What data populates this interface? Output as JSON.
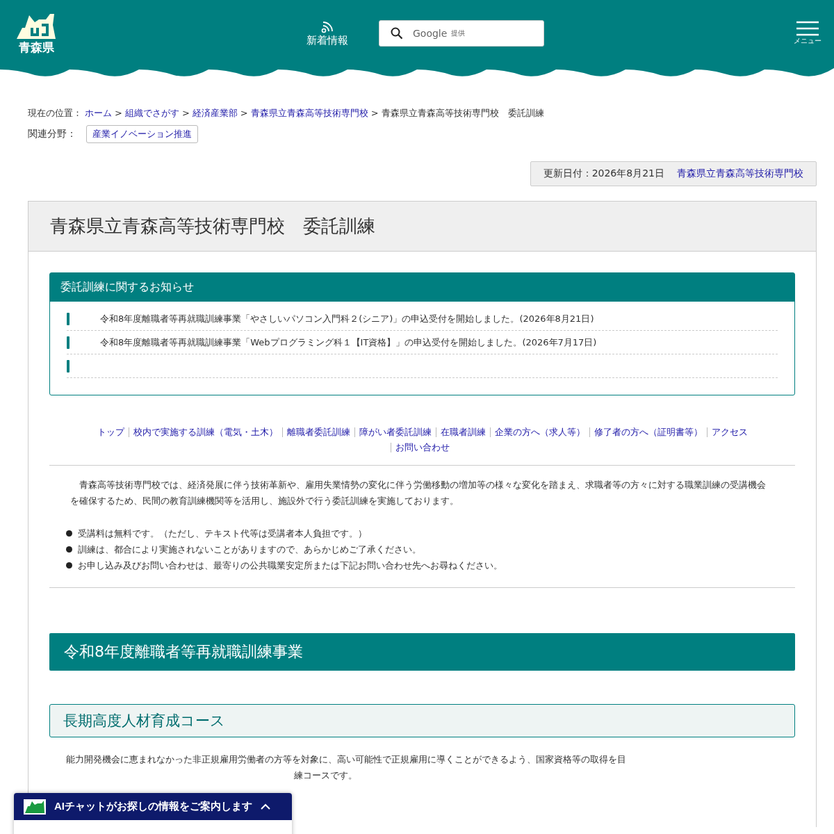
{
  "header": {
    "logo_text": "青森県",
    "news_label": "新着情報",
    "search": {
      "brand": "Google",
      "suffix": "提供"
    },
    "menu_label": "メニュー"
  },
  "breadcrumb": {
    "label": "現在の位置：",
    "separator": ">",
    "items": [
      {
        "text": "ホーム",
        "link": true
      },
      {
        "text": "組織でさがす",
        "link": true
      },
      {
        "text": "経済産業部",
        "link": true
      },
      {
        "text": "青森県立青森高等技術専門校",
        "link": true
      },
      {
        "text": "青森県立青森高等技術専門校　委託訓練",
        "link": false
      }
    ]
  },
  "related": {
    "label": "関連分野：",
    "tags": [
      "産業イノベーション推進"
    ]
  },
  "updated": {
    "date": "更新日付：2026年8月21日",
    "department": "青森県立青森高等技術専門校"
  },
  "title": "青森県立青森高等技術専門校　委託訓練",
  "notice": {
    "heading": "委託訓練に関するお知らせ",
    "items": [
      {
        "kind": "notice",
        "text": "令和8年度離職者等再就職訓練事業「やさしいパソコン入門科２(シニア)」の申込受付を開始しました。(2026年8月21日)"
      },
      {
        "kind": "notice",
        "text": "令和8年度離職者等再就職訓練事業「Webプログラミング科１【IT資格】」の申込受付を開始しました。(2026年7月17日)"
      },
      {
        "kind": "blank"
      }
    ]
  },
  "nav_links": [
    "トップ",
    "校内で実施する訓練（電気・土木）",
    "離職者委託訓練",
    "障がい者委託訓練",
    "在職者訓練",
    "企業の方へ（求人等）",
    "修了者の方へ（証明書等）",
    "アクセス",
    "お問い合わせ"
  ],
  "intro": "　青森高等技術専門校では、経済発展に伴う技術革新や、雇用失業情勢の変化に伴う労働移動の増加等の様々な変化を踏まえ、求職者等の方々に対する職業訓練の受講機会を確保するため、民間の教育訓練機関等を活用し、施設外で行う委託訓練を実施しております。",
  "bullets": [
    "受講料は無料です。（ただし、テキスト代等は受講者本人負担です。）",
    "訓練は、都合により実施されないことがありますので、あらかじめご了承ください。",
    "お申し込み及びお問い合わせは、最寄りの公共職業安定所または下記お問い合わせ先へお尋ねください。"
  ],
  "section_heading": "令和8年度離職者等再就職訓練事業",
  "subsection_heading": "長期高度人材育成コース",
  "course_text_lines": [
    "能力開発機会に恵まれなかった非正規雇用労働者の方等を対象に、高い可能性で正規雇用に導くことができるよう、国家資格等の取得を目",
    "練コースです。"
  ],
  "chat": {
    "label": "AIチャットがお探しの情報をご案内します"
  }
}
